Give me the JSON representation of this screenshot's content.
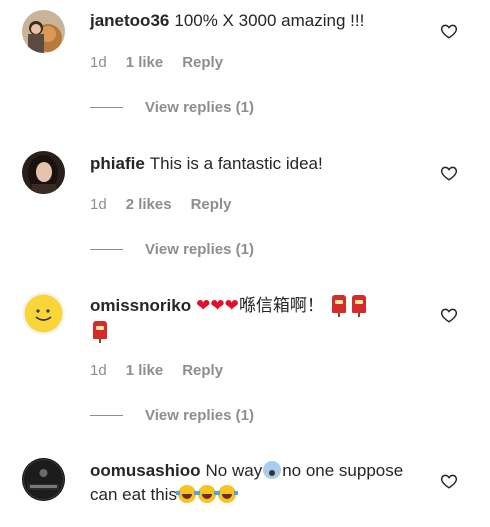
{
  "comments": [
    {
      "username": "janetoo36",
      "text": "100% X 3000 amazing !!!",
      "time": "1d",
      "likes": "1 like",
      "reply_label": "Reply",
      "view_replies": "View replies (1)"
    },
    {
      "username": "phiafie",
      "text": "This is a fantastic idea!",
      "time": "1d",
      "likes": "2 likes",
      "reply_label": "Reply",
      "view_replies": "View replies (1)"
    },
    {
      "username": "omissnoriko",
      "text_hearts": "❤❤❤",
      "text": "喺信箱啊！",
      "time": "1d",
      "likes": "1 like",
      "reply_label": "Reply",
      "view_replies": "View replies (1)"
    },
    {
      "username": "oomusashioo",
      "text_part1": "No way",
      "text_part2": "no one suppose can eat this"
    }
  ],
  "icons": {
    "like": "heart-outline-icon",
    "postbox": "postbox-emoji",
    "scream": "screaming-face-emoji",
    "laugh": "face-with-tears-of-joy-emoji"
  },
  "colors": {
    "text": "#262626",
    "muted": "#8e8e8e",
    "heart_red": "#e0102a"
  }
}
